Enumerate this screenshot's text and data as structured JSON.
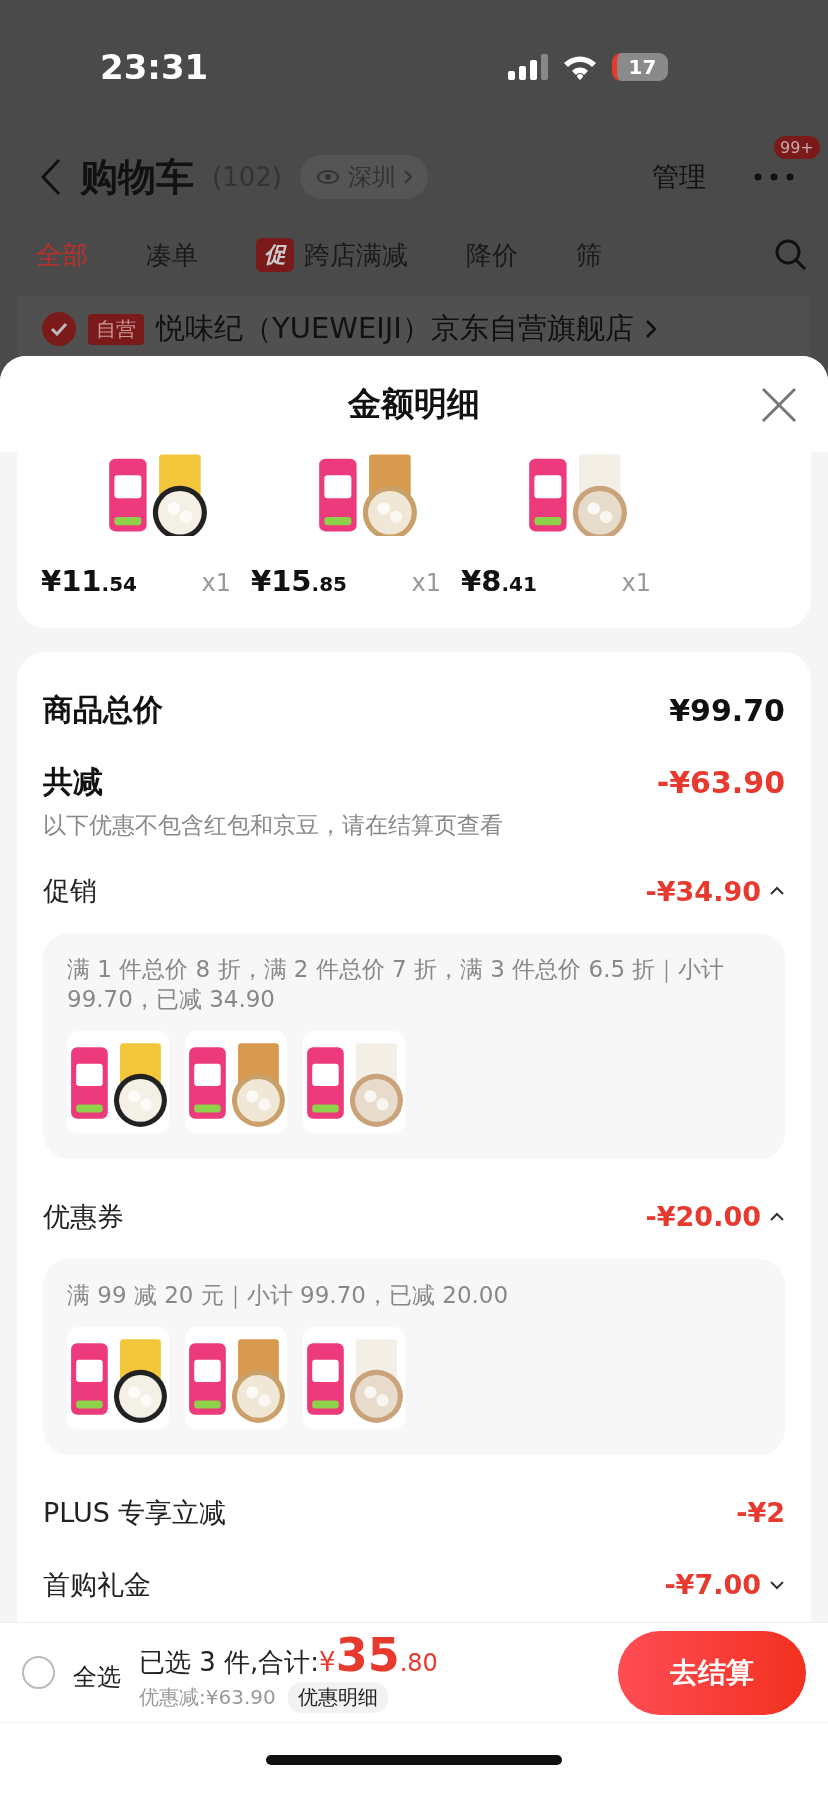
{
  "status_bar": {
    "time": "23:31",
    "battery": "17"
  },
  "header": {
    "title": "购物车",
    "count": "(102)",
    "location": "深圳",
    "manage": "管理",
    "more_badge": "99+"
  },
  "tabs": [
    {
      "label": "全部",
      "selected": true
    },
    {
      "label": "凑单",
      "selected": false
    },
    {
      "label": "跨店满减",
      "badge": "促",
      "selected": false
    },
    {
      "label": "降价",
      "selected": false
    },
    {
      "label": "筛",
      "selected": false
    }
  ],
  "store": {
    "checked": true,
    "tag": "自营",
    "name": "悦味纪（YUEWEIJI）京东自营旗舰店"
  },
  "sheet": {
    "title": "金额明细"
  },
  "items": [
    {
      "currency": "¥",
      "price_main": "11",
      "price_decimals": ".54",
      "qty": "x1"
    },
    {
      "currency": "¥",
      "price_main": "15",
      "price_decimals": ".85",
      "qty": "x1"
    },
    {
      "currency": "¥",
      "price_main": "8",
      "price_decimals": ".41",
      "qty": "x1"
    }
  ],
  "summary": {
    "total_label": "商品总价",
    "total": "¥99.70",
    "reduce_label": "共减",
    "reduce": "-¥63.90",
    "note": "以下优惠不包含红包和京豆，请在结算页查看"
  },
  "discounts": [
    {
      "kind": "expandable",
      "label": "促销",
      "amount": "-¥34.90",
      "expanded": true,
      "detail": "满 1 件总价 8 折，满 2 件总价 7 折，满 3 件总价 6.5 折｜小计 99.70，已减 34.90"
    },
    {
      "kind": "expandable",
      "label": "优惠券",
      "amount": "-¥20.00",
      "expanded": true,
      "detail": "满 99 减 20 元｜小计 99.70，已减 20.00"
    },
    {
      "kind": "plain",
      "label": "PLUS 专享立减",
      "amount": "-¥2"
    },
    {
      "kind": "expandable",
      "label": "首购礼金",
      "amount": "-¥7.00",
      "expanded": false
    }
  ],
  "bottom": {
    "select_all": "全选",
    "checked": false,
    "selected_text": "已选 3 件,合计:",
    "currency": "¥",
    "total_main": "35",
    "total_decimals": ".80",
    "saving": "优惠减:¥63.90",
    "detail_link": "优惠明细",
    "checkout": "去结算"
  }
}
